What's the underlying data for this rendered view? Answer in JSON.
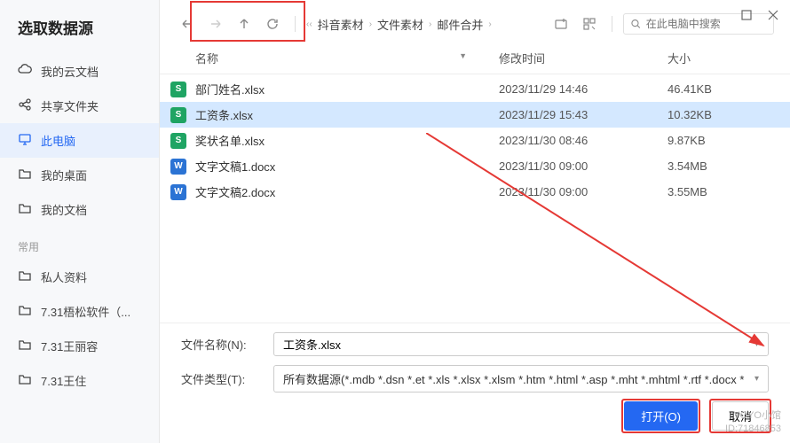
{
  "title": "选取数据源",
  "sidebar": {
    "items": [
      {
        "icon": "cloud",
        "label": "我的云文档"
      },
      {
        "icon": "share",
        "label": "共享文件夹"
      },
      {
        "icon": "monitor",
        "label": "此电脑",
        "active": true
      },
      {
        "icon": "folder",
        "label": "我的桌面"
      },
      {
        "icon": "folder",
        "label": "我的文档"
      }
    ],
    "section": "常用",
    "recent": [
      {
        "label": "私人资料"
      },
      {
        "label": "7.31梧松软件（..."
      },
      {
        "label": "7.31王丽容"
      },
      {
        "label": "7.31王住"
      }
    ]
  },
  "breadcrumb": [
    "抖音素材",
    "文件素材",
    "邮件合并"
  ],
  "search_placeholder": "在此电脑中搜索",
  "headers": {
    "name": "名称",
    "date": "修改时间",
    "size": "大小"
  },
  "files": [
    {
      "icon": "S",
      "iconClass": "fi-s",
      "name": "部门姓名.xlsx",
      "date": "2023/11/29 14:46",
      "size": "46.41KB"
    },
    {
      "icon": "S",
      "iconClass": "fi-s",
      "name": "工资条.xlsx",
      "date": "2023/11/29 15:43",
      "size": "10.32KB",
      "selected": true
    },
    {
      "icon": "S",
      "iconClass": "fi-s",
      "name": "奖状名单.xlsx",
      "date": "2023/11/30 08:46",
      "size": "9.87KB"
    },
    {
      "icon": "W",
      "iconClass": "fi-w",
      "name": "文字文稿1.docx",
      "date": "2023/11/30 09:00",
      "size": "3.54MB"
    },
    {
      "icon": "W",
      "iconClass": "fi-w",
      "name": "文字文稿2.docx",
      "date": "2023/11/30 09:00",
      "size": "3.55MB"
    }
  ],
  "filename_label": "文件名称(N):",
  "filename_value": "工资条.xlsx",
  "filetype_label": "文件类型(T):",
  "filetype_value": "所有数据源(*.mdb *.dsn *.et *.xls *.xlsx *.xlsm *.htm *.html *.asp *.mht *.mhtml *.rtf *.docx *",
  "open_btn": "打开(O)",
  "cancel_btn": "取消",
  "watermark1": "YOYO小馆",
  "watermark2": "ID:71846853"
}
